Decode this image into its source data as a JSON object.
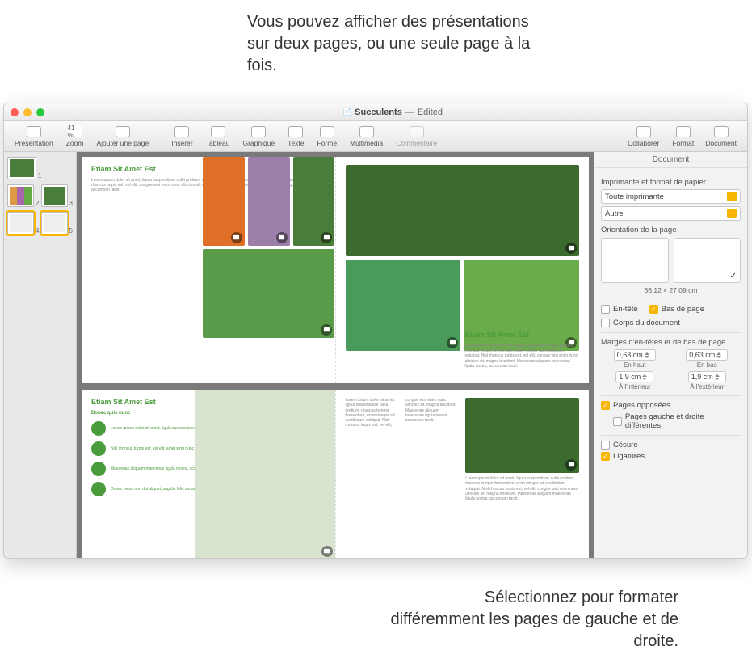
{
  "callouts": {
    "top": "Vous pouvez afficher des présentations sur deux pages, ou une seule page à la fois.",
    "bottom": "Sélectionnez pour formater différemment les pages de gauche et de droite."
  },
  "titlebar": {
    "filename": "Succulents",
    "status": "Edited"
  },
  "toolbar": {
    "presentation": "Présentation",
    "zoom": "Zoom",
    "zoom_value": "41 %",
    "add_page": "Ajouter une page",
    "insert": "Insérer",
    "table": "Tableau",
    "chart": "Graphique",
    "text": "Texte",
    "shape": "Forme",
    "media": "Multimédia",
    "comment": "Commentaire",
    "collaborate": "Collaborer",
    "format": "Format",
    "document": "Document"
  },
  "thumbs": [
    "1",
    "2",
    "3",
    "4",
    "5"
  ],
  "content": {
    "heading1": "Etiam Sit Amet Est",
    "heading2": "Etiam Sit Amet Est",
    "heading3": "Etiam Sit Amet Est",
    "sub": "Donec quis nunc",
    "list": {
      "a": "Lorem ipsum dolor sit amet, ligula suspendisse nulla",
      "b": "Nisl rhoncus turpis est, vel elit, amet wrm nunc luctus",
      "c": "Maecenas aliquam maecenas ligula nostra, accumsan",
      "d": "Donec netus non dui aliquet, sagittis felis sodai sociis mauris"
    },
    "lorem_block": "Lorem ipsum dolor sit amet, ligula suspendisse nulla pretium, rhoncus tempor fermentum, enim integer ad vestibulum volutpat. Nisl rhoncus turpis est, vel elit, congue wisi enim nunc ultricies sit, magna tincidunt. Maecenas aliquam maecenas ligula nostra, accumsan taciti."
  },
  "inspector": {
    "tab": "Document",
    "printer_section": "Imprimante et format de papier",
    "printer": "Toute imprimante",
    "paper": "Autre",
    "orientation_label": "Orientation de la page",
    "dims": "36,12 × 27,09 cm",
    "header": "En-tête",
    "footer": "Bas de page",
    "body": "Corps du document",
    "margins_label": "Marges d'en-têtes et de bas de page",
    "m_top": "0,63 cm",
    "m_top_l": "En haut",
    "m_bot": "0,63 cm",
    "m_bot_l": "En bas",
    "m_in": "1,9 cm",
    "m_in_l": "À l'intérieur",
    "m_out": "1,9 cm",
    "m_out_l": "À l'extérieur",
    "facing": "Pages opposées",
    "different": "Pages gauche et droite différentes",
    "hyphen": "Césure",
    "ligatures": "Ligatures"
  }
}
